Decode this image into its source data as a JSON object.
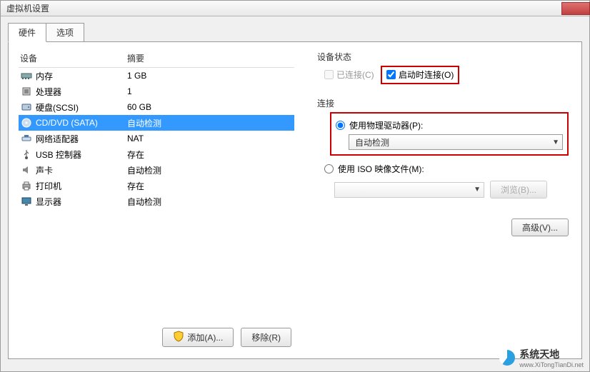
{
  "window": {
    "title": "虚拟机设置"
  },
  "tabs": {
    "hardware": "硬件",
    "options": "选项"
  },
  "columns": {
    "device": "设备",
    "summary": "摘要"
  },
  "devices": [
    {
      "name": "内存",
      "summary": "1 GB",
      "icon": "memory"
    },
    {
      "name": "处理器",
      "summary": "1",
      "icon": "cpu"
    },
    {
      "name": "硬盘(SCSI)",
      "summary": "60 GB",
      "icon": "hdd"
    },
    {
      "name": "CD/DVD (SATA)",
      "summary": "自动检测",
      "icon": "cd",
      "selected": true
    },
    {
      "name": "网络适配器",
      "summary": "NAT",
      "icon": "net"
    },
    {
      "name": "USB 控制器",
      "summary": "存在",
      "icon": "usb"
    },
    {
      "name": "声卡",
      "summary": "自动检测",
      "icon": "sound"
    },
    {
      "name": "打印机",
      "summary": "存在",
      "icon": "printer"
    },
    {
      "name": "显示器",
      "summary": "自动检测",
      "icon": "display"
    }
  ],
  "buttons": {
    "add": "添加(A)...",
    "remove": "移除(R)",
    "browse": "浏览(B)...",
    "advanced": "高级(V)..."
  },
  "status": {
    "group": "设备状态",
    "connected": "已连接(C)",
    "connect_at_power_on": "启动时连接(O)"
  },
  "connection": {
    "group": "连接",
    "use_physical": "使用物理驱动器(P):",
    "physical_value": "自动检测",
    "use_iso": "使用 ISO 映像文件(M):",
    "iso_value": ""
  },
  "watermark": {
    "big": "系统天地",
    "small": "www.XiTongTianDi.net"
  }
}
